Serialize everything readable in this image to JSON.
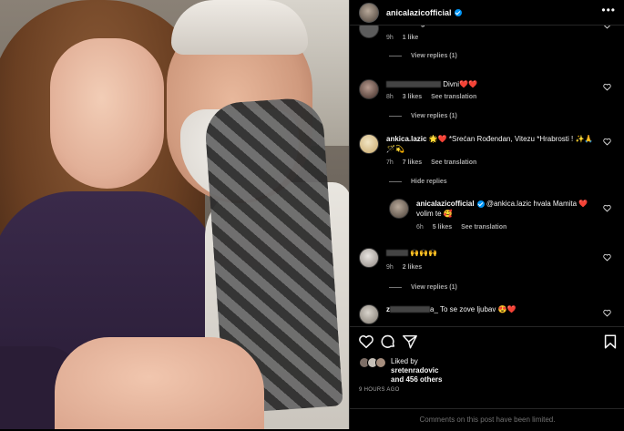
{
  "post": {
    "username": "anicalazicofficial",
    "more_icon": "more-horizontal-icon"
  },
  "comments": [
    {
      "user": "tamaramagnsrovic",
      "text": "",
      "time": "9h",
      "likes": "1 like",
      "translate": "",
      "view_replies": "View replies (1)"
    },
    {
      "user": "",
      "text": "Divni❤️❤️",
      "time": "8h",
      "likes": "3 likes",
      "translate": "See translation",
      "view_replies": "View replies (1)"
    },
    {
      "user": "ankica.lazic",
      "text": "🌟❤️ *Srećan Rođendan, Vitezu *Hrabrosti ! ✨🙏🪄💫",
      "time": "7h",
      "likes": "7 likes",
      "translate": "See translation",
      "view_replies": "Hide replies"
    },
    {
      "user": "anicalazicofficial",
      "text": "@ankica.lazic hvala Mamita ❤️ volim te 🥰",
      "time": "6h",
      "likes": "5 likes",
      "translate": "See translation",
      "view_replies": ""
    },
    {
      "user": "",
      "text": "🙌🙌🙌",
      "time": "9h",
      "likes": "2 likes",
      "translate": "",
      "view_replies": "View replies (1)"
    },
    {
      "user": "z",
      "text": "a_ To se zove ljubav 😍❤️",
      "time": "",
      "likes": "",
      "translate": "",
      "view_replies": ""
    }
  ],
  "actions": {
    "liked_by_label": "Liked by",
    "liked_by_user": "sretenradovic",
    "and_others": "and 456 others",
    "time_ago": "9 HOURS AGO",
    "comments_limited": "Comments on this post have been limited."
  }
}
